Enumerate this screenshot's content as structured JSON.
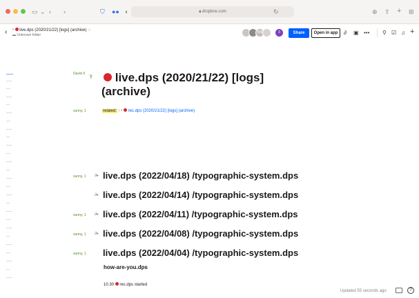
{
  "browser": {
    "address": "dropbox.com"
  },
  "header": {
    "doc_title": "live.dps (2020/21/22) [logs] (archive)",
    "folder": "Unknown folder",
    "avatar_more": "3",
    "avatar_initials": "BM",
    "share_label": "Share",
    "open_in_app_label": "Open in app"
  },
  "document": {
    "author_top": "David X",
    "title_line1": "live.dps (2020/21/22) [logs]",
    "title_line2": "(archive)",
    "related_author": "sunny, 1",
    "related_label": "related:",
    "related_link": "rec.dps (2020/21/22) [logs] (archive)",
    "entries": [
      {
        "author": "sunny, 1",
        "text": "live.dps (2022/04/18) /typographic-system.dps"
      },
      {
        "author": "",
        "text": "live.dps (2022/04/14) /typographic-system.dps"
      },
      {
        "author": "sunny, 1",
        "text": "live.dps (2022/04/11) /typographic-system.dps"
      },
      {
        "author": "sunny, 1",
        "text": "live.dps (2022/04/08) /typographic-system.dps"
      },
      {
        "author": "sunny, 1",
        "text": "live.dps (2022/04/04) /typographic-system.dps"
      }
    ],
    "sub_heading": "how-are-you.dps",
    "log_time": "10.30",
    "log_text": "rec.dps started"
  },
  "footer": {
    "status": "Updated 55 seconds ago"
  },
  "colors": {
    "brand_blue": "#0061fe",
    "author_green": "#4e8b22",
    "highlight_yellow": "#f8ec7a",
    "emoji_red": "#d9262e"
  }
}
